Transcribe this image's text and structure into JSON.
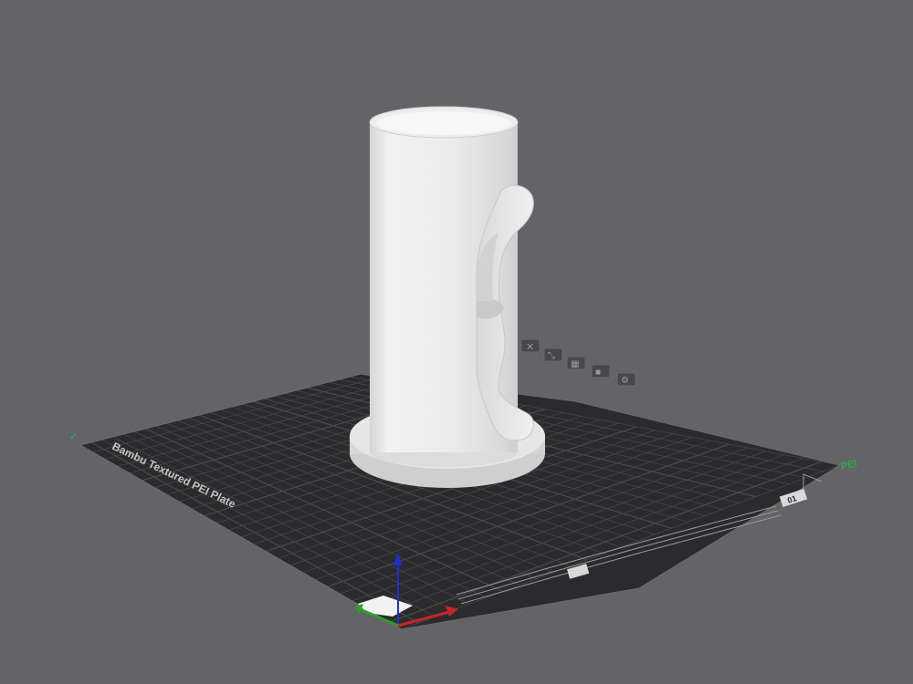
{
  "viewport": {
    "background": "#636368",
    "plate_color": "#2b2b2d",
    "plate_grid_color": "#4a4a4d",
    "model_color": "#e7e7e7"
  },
  "plate": {
    "name_label": "Bambu Textured PEI Plate",
    "bottom_corner_label": "01",
    "top_corner_label": "PEI"
  },
  "axes": {
    "x_color": "#c8242b",
    "y_color": "#2aa02a",
    "z_color": "#1e2fcf"
  },
  "plate_icons": [
    {
      "icon": "close-icon"
    },
    {
      "icon": "orient-icon"
    },
    {
      "icon": "arrange-icon"
    },
    {
      "icon": "lock-icon"
    },
    {
      "icon": "settings-icon"
    }
  ]
}
